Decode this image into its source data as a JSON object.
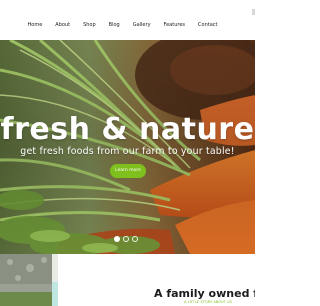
{
  "nav": {
    "items": [
      {
        "label": "Home"
      },
      {
        "label": "About"
      },
      {
        "label": "Shop"
      },
      {
        "label": "Blog"
      },
      {
        "label": "Gallery"
      },
      {
        "label": "Features"
      },
      {
        "label": "Contact"
      }
    ]
  },
  "hero": {
    "title": "fresh & nature",
    "subtitle": "get fresh foods from our farm to your table!",
    "button_label": "Learn more",
    "slide_count": 3,
    "active_slide": 1
  },
  "about": {
    "title": "A family owned fa",
    "subtitle": "A LITTLE STORY ABOUT US"
  },
  "colors": {
    "accent": "#7fbf1e",
    "hero_text": "#ffffff",
    "heading": "#1c1c1c"
  }
}
